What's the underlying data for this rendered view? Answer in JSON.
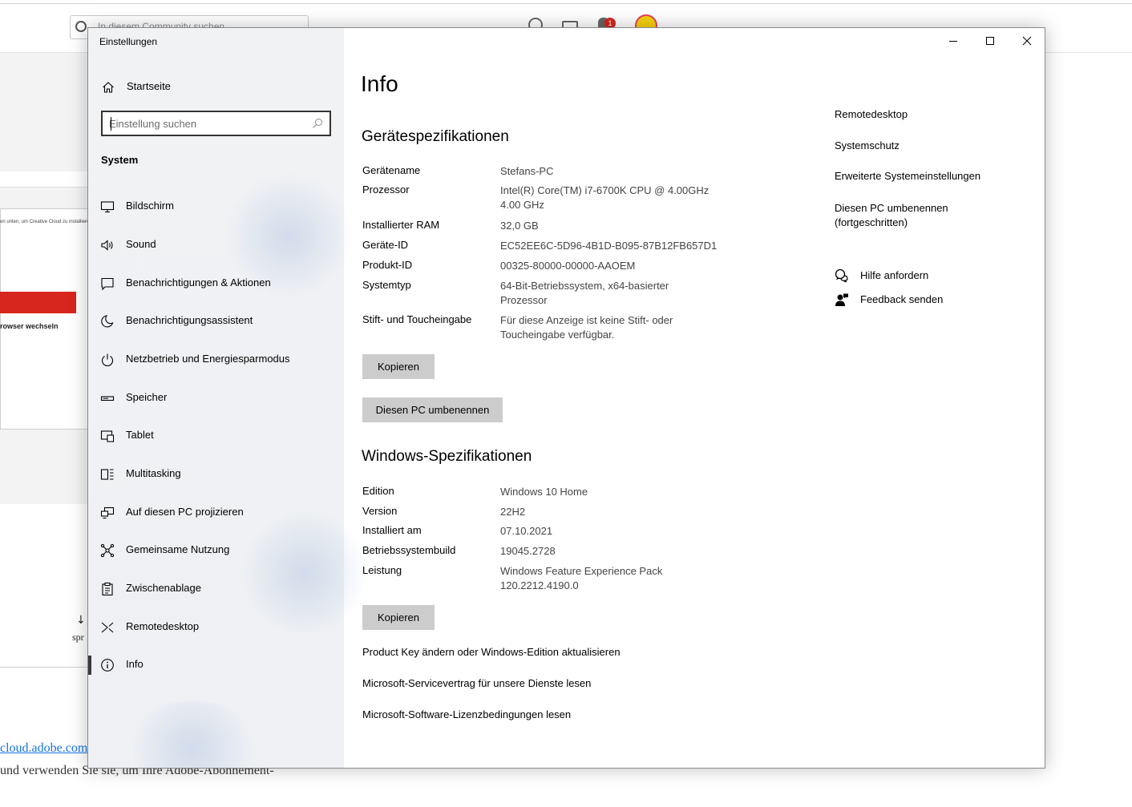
{
  "background": {
    "search_placeholder": "In diesem Community suchen",
    "notification_count": "1",
    "screenshot_text": "en unten, um Creative Cloud zu installieren",
    "browser_heading": "rowser wechseln",
    "download_text": "spr",
    "link_text": "cloud.adobe.com",
    "bottom_text": "und verwenden Sie sie, um Ihre Adobe-Abonnement-"
  },
  "window": {
    "title": "Einstellungen",
    "controls": {
      "minimize": "minimize-icon",
      "maximize": "maximize-icon",
      "close": "close-icon"
    }
  },
  "nav": {
    "home_label": "Startseite",
    "search_placeholder": "Einstellung suchen",
    "section_label": "System",
    "items": [
      {
        "label": "Bildschirm",
        "icon": "monitor-icon"
      },
      {
        "label": "Sound",
        "icon": "speaker-icon"
      },
      {
        "label": "Benachrichtigungen & Aktionen",
        "icon": "notification-icon"
      },
      {
        "label": "Benachrichtigungsassistent",
        "icon": "moon-icon"
      },
      {
        "label": "Netzbetrieb und Energiesparmodus",
        "icon": "power-icon"
      },
      {
        "label": "Speicher",
        "icon": "storage-icon"
      },
      {
        "label": "Tablet",
        "icon": "tablet-icon"
      },
      {
        "label": "Multitasking",
        "icon": "multitasking-icon"
      },
      {
        "label": "Auf diesen PC projizieren",
        "icon": "project-icon"
      },
      {
        "label": "Gemeinsame Nutzung",
        "icon": "share-icon"
      },
      {
        "label": "Zwischenablage",
        "icon": "clipboard-icon"
      },
      {
        "label": "Remotedesktop",
        "icon": "remote-desktop-icon"
      },
      {
        "label": "Info",
        "icon": "info-icon",
        "active": true
      }
    ]
  },
  "main": {
    "title": "Info",
    "device_specs": {
      "heading": "Gerätespezifikationen",
      "rows": [
        {
          "key": "Gerätename",
          "value": "Stefans-PC"
        },
        {
          "key": "Prozessor",
          "value": "Intel(R) Core(TM) i7-6700K CPU @ 4.00GHz 4.00 GHz"
        },
        {
          "key": "Installierter RAM",
          "value": "32,0 GB"
        },
        {
          "key": "Geräte-ID",
          "value": "EC52EE6C-5D96-4B1D-B095-87B12FB657D1"
        },
        {
          "key": "Produkt-ID",
          "value": "00325-80000-00000-AAOEM"
        },
        {
          "key": "Systemtyp",
          "value": "64-Bit-Betriebssystem, x64-basierter Prozessor"
        },
        {
          "key": "Stift- und Toucheingabe",
          "value": "Für diese Anzeige ist keine Stift- oder Toucheingabe verfügbar."
        }
      ],
      "copy_button": "Kopieren",
      "rename_button": "Diesen PC umbenennen"
    },
    "windows_specs": {
      "heading": "Windows-Spezifikationen",
      "rows": [
        {
          "key": "Edition",
          "value": "Windows 10 Home"
        },
        {
          "key": "Version",
          "value": "22H2"
        },
        {
          "key": "Installiert am",
          "value": "07.10.2021"
        },
        {
          "key": "Betriebssystembuild",
          "value": "19045.2728"
        },
        {
          "key": "Leistung",
          "value": "Windows Feature Experience Pack 120.2212.4190.0"
        }
      ],
      "copy_button": "Kopieren"
    },
    "links": [
      "Product Key ändern oder Windows-Edition aktualisieren",
      "Microsoft-Servicevertrag für unsere Dienste lesen",
      "Microsoft-Software-Lizenzbedingungen lesen"
    ]
  },
  "related": {
    "links": [
      "Remotedesktop",
      "Systemschutz",
      "Erweiterte Systemeinstellungen",
      "Diesen PC umbenennen (fortgeschritten)"
    ],
    "help": [
      {
        "label": "Hilfe anfordern",
        "icon": "help-chat-icon"
      },
      {
        "label": "Feedback senden",
        "icon": "feedback-icon"
      }
    ]
  }
}
